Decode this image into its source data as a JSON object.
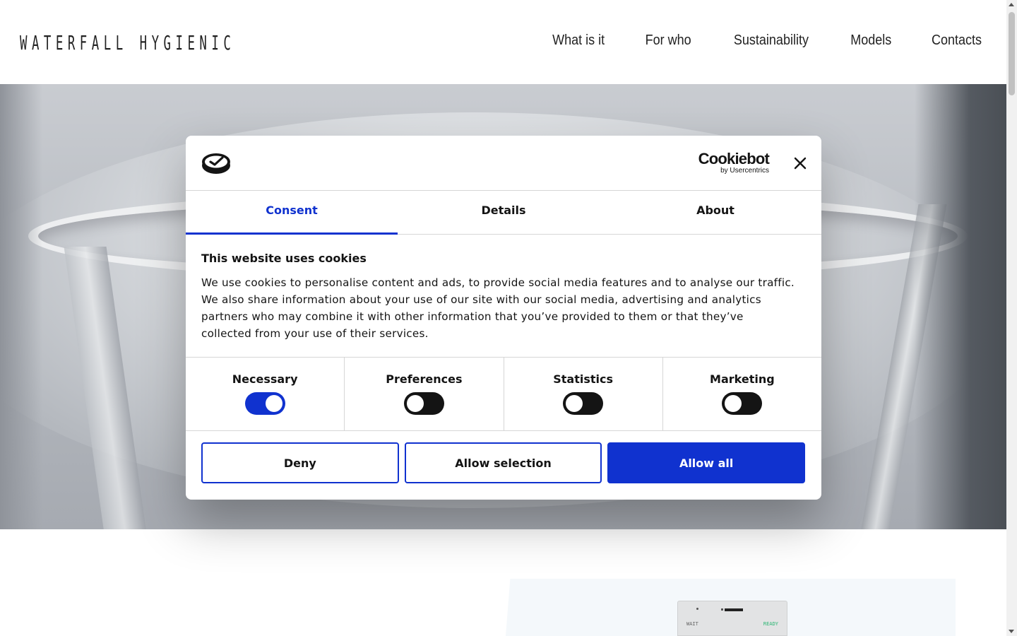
{
  "header": {
    "logo_text": "WATERFALL HYGIENIC",
    "nav": [
      "What is it",
      "For who",
      "Sustainability",
      "Models",
      "Contacts"
    ]
  },
  "device": {
    "wait_label": "WAIT",
    "ready_label": "READY"
  },
  "cookie_dialog": {
    "brand_name": "Cookiebot",
    "brand_sub": "by Usercentrics",
    "tabs": [
      "Consent",
      "Details",
      "About"
    ],
    "active_tab": "Consent",
    "title": "This website uses cookies",
    "description": "We use cookies to personalise content and ads, to provide social media features and to analyse our traffic. We also share information about your use of our site with our social media, advertising and analytics partners who may combine it with other information that you’ve provided to them or that they’ve collected from your use of their services.",
    "categories": [
      {
        "label": "Necessary",
        "enabled": true
      },
      {
        "label": "Preferences",
        "enabled": false
      },
      {
        "label": "Statistics",
        "enabled": false
      },
      {
        "label": "Marketing",
        "enabled": false
      }
    ],
    "buttons": {
      "deny": "Deny",
      "allow_selection": "Allow selection",
      "allow_all": "Allow all"
    }
  },
  "colors": {
    "accent": "#1032cf",
    "text": "#141414",
    "divider": "#d6d6d6"
  }
}
